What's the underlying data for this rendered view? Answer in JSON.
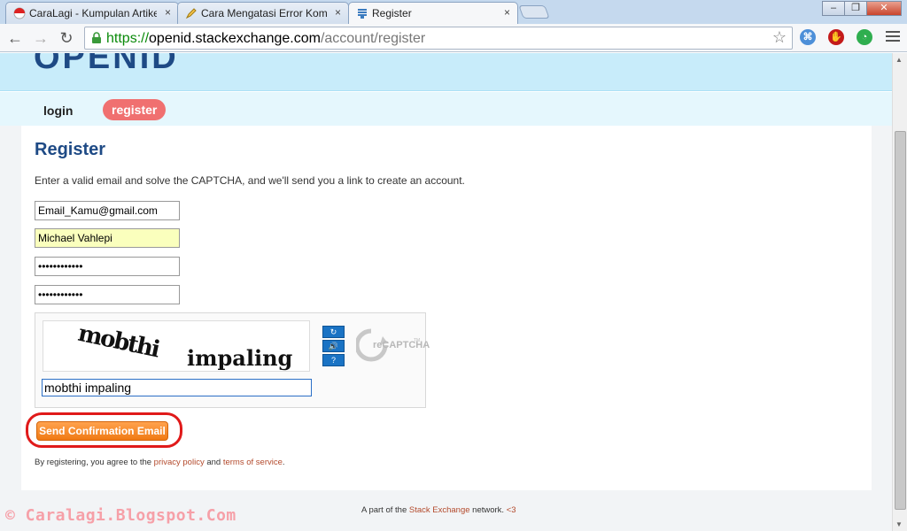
{
  "browser": {
    "tabs": [
      {
        "title": "CaraLagi - Kumpulan Artikel",
        "close": "×"
      },
      {
        "title": "Cara Mengatasi Error Komentar",
        "close": "×"
      },
      {
        "title": "Register",
        "close": "×"
      }
    ],
    "window_controls": {
      "minimize": "–",
      "maximize": "❐",
      "close": "✕"
    },
    "address": {
      "scheme": "https://",
      "host": "openid.stackexchange.com",
      "path": "/account/register"
    },
    "nav": {
      "back": "←",
      "forward": "→",
      "reload": "↻"
    }
  },
  "site": {
    "logo": "OPENID",
    "nav": {
      "login": "login",
      "register": "register"
    }
  },
  "form": {
    "title": "Register",
    "intro": "Enter a valid email and solve the CAPTCHA, and we'll send you a link to create an account.",
    "email": "Email_Kamu@gmail.com",
    "name": "Michael Vahlepi",
    "password": "••••••••••••",
    "password_confirm": "••••••••••••",
    "captcha": {
      "word1": "mobthi",
      "word2": "impaling",
      "response": "mobthi impaling",
      "reload_icon": "↻",
      "audio_icon": "🔊",
      "help_icon": "?",
      "brand": "reCAPTCHA",
      "brand_tm": "TM"
    },
    "submit_label": "Send Confirmation Email",
    "terms_prefix": "By registering, you agree to the ",
    "privacy_link": "privacy policy",
    "terms_and": " and ",
    "terms_link": "terms of service",
    "terms_suffix": "."
  },
  "footer": {
    "prefix": "A part of the ",
    "network_link": "Stack Exchange",
    "suffix": " network. ",
    "heart": "<3"
  },
  "watermark": "© Caralagi.Blogspot.Com",
  "colors": {
    "brand": "#1e4a85",
    "nav_active": "#f07070",
    "header_bg": "#c8ecfa",
    "submit": "#f07a14",
    "highlight": "#e01a1a"
  }
}
